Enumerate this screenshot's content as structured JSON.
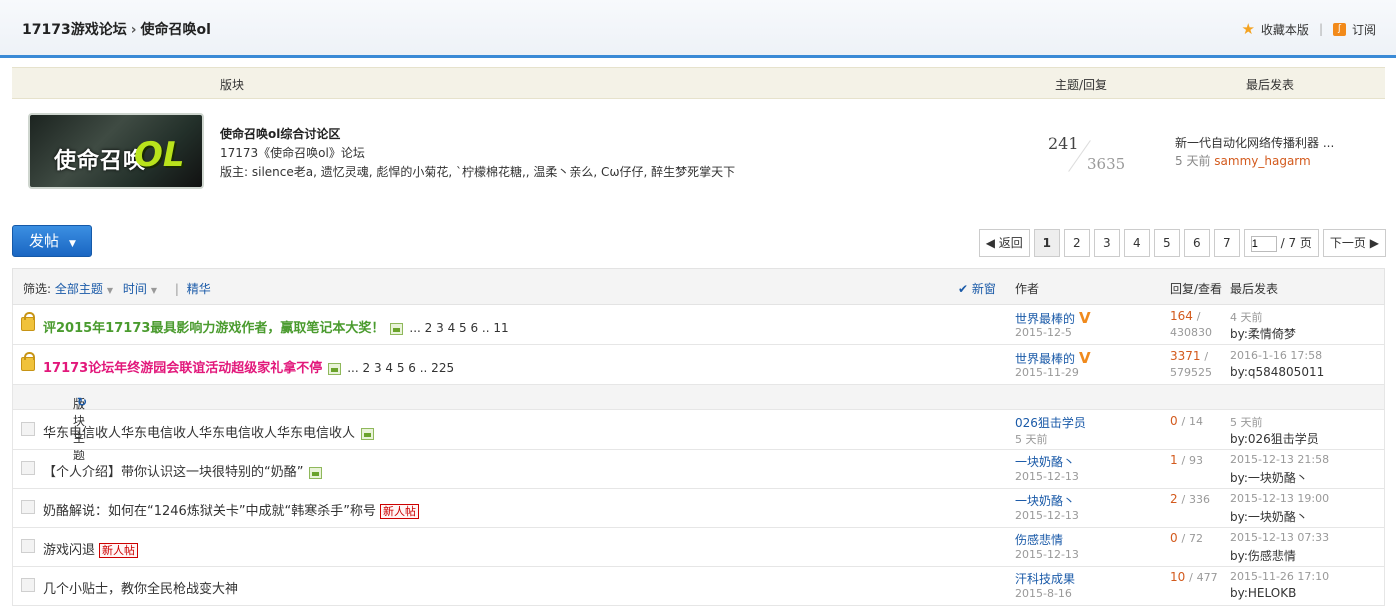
{
  "breadcrumb": {
    "home": "17173游戏论坛",
    "sep": "›",
    "current": "使命召唤ol"
  },
  "top_actions": {
    "favorite": "收藏本版",
    "subscribe": "订阅",
    "rss_glyph": "ʃ"
  },
  "forum_header": {
    "col_board": "版块",
    "col_counts": "主题/回复",
    "col_last": "最后发表"
  },
  "forum": {
    "logo_text1": "使命召唤",
    "logo_text2": "OL",
    "name": "使命召唤ol综合讨论区",
    "desc": "17173《使命召唤ol》论坛",
    "mods": "版主: silence老a, 遗忆灵魂, 彪悍的小菊花, `柠檬棉花糖,, 温柔丶亲么, Cω仔仔, 醉生梦死掌天下",
    "topics": "241",
    "replies": "3635",
    "last_title": "新一代自动化网络传播利器 ...",
    "last_time": "5 天前",
    "last_user": "sammy_hagarm"
  },
  "post_button": "发帖",
  "pager": {
    "back": "返回",
    "pages": [
      "1",
      "2",
      "3",
      "4",
      "5",
      "6",
      "7"
    ],
    "current": "1",
    "input_value": "1",
    "total": "/ 7 页",
    "next": "下一页"
  },
  "filter": {
    "label": "筛选:",
    "all": "全部主题",
    "time": "时间",
    "digest": "精华",
    "newwin": "新窗",
    "col_author": "作者",
    "col_reply": "回复/查看",
    "col_last": "最后发表"
  },
  "section_label": "版块主题",
  "sticky": [
    {
      "title": "评2015年17173最具影响力游戏作者，赢取笔记本大奖！",
      "pages": "... 2 3 4 5 6 .. 11",
      "author": "世界最棒的",
      "date": "2015-12-5",
      "replies": "164",
      "views": "430830",
      "last_time": "4 天前",
      "last_by": "by:柔情倚梦"
    },
    {
      "title": "17173论坛年终游园会联谊活动超级家礼拿不停",
      "pages": "... 2 3 4 5 6 .. 225",
      "author": "世界最棒的",
      "date": "2015-11-29",
      "replies": "3371",
      "views": "579525",
      "last_time": "2016-1-16 17:58",
      "last_by": "by:q584805011"
    }
  ],
  "threads": [
    {
      "title": "华东电信收人华东电信收人华东电信收人华东电信收人",
      "author": "026狙击学员",
      "date": "5 天前",
      "replies": "0",
      "views": "14",
      "last_time": "5 天前",
      "last_by": "by:026狙击学员",
      "new": ""
    },
    {
      "title": "【个人介绍】带你认识这一块很特别的“奶酪”",
      "author": "一块奶酪丶",
      "date": "2015-12-13",
      "replies": "1",
      "views": "93",
      "last_time": "2015-12-13 21:58",
      "last_by": "by:一块奶酪丶",
      "new": ""
    },
    {
      "title": "奶酪解说：如何在“1246炼狱关卡”中成就“韩寒杀手”称号",
      "author": "一块奶酪丶",
      "date": "2015-12-13",
      "replies": "2",
      "views": "336",
      "last_time": "2015-12-13 19:00",
      "last_by": "by:一块奶酪丶",
      "new": "新人帖"
    },
    {
      "title": "游戏闪退",
      "author": "伤感悲情",
      "date": "2015-12-13",
      "replies": "0",
      "views": "72",
      "last_time": "2015-12-13 07:33",
      "last_by": "by:伤感悲情",
      "new": "新人帖"
    },
    {
      "title": "几个小贴士，教你全民枪战变大神",
      "author": "汗科技成果",
      "date": "2015-8-16",
      "replies": "10",
      "views": "477",
      "last_time": "2015-11-26 17:10",
      "last_by": "by:HELOKB",
      "new": ""
    }
  ]
}
